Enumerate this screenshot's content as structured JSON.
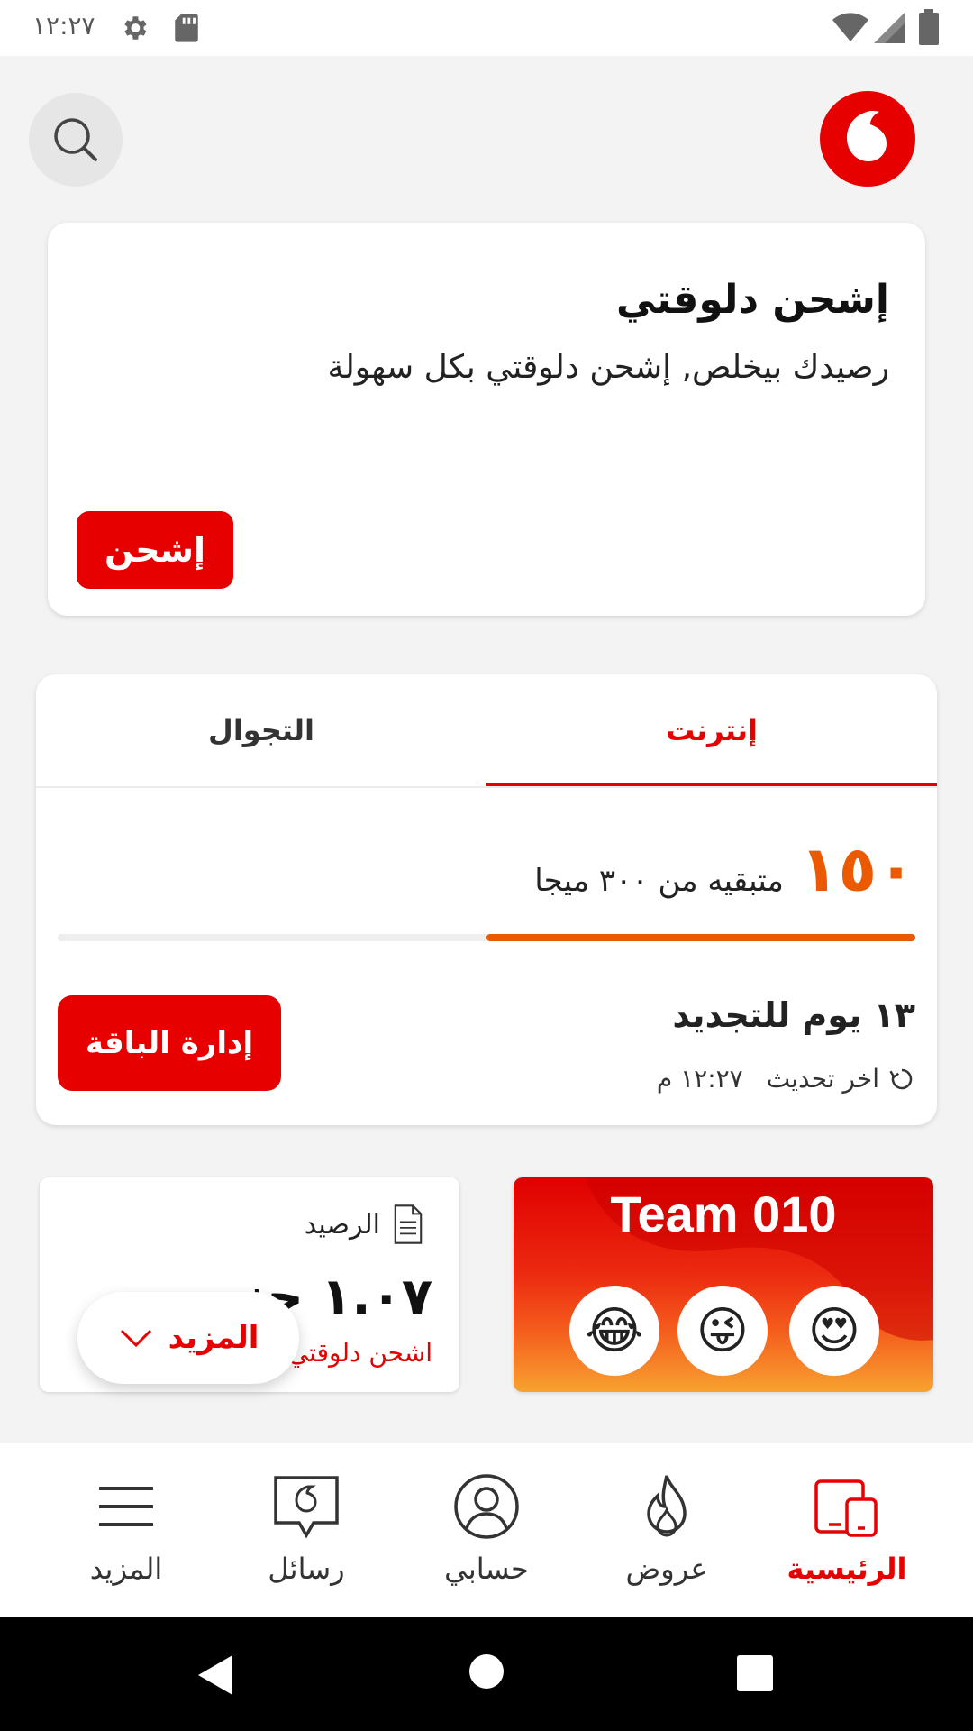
{
  "status_bar": {
    "time": "١٢:٢٧"
  },
  "header": {
    "search_icon": "search-icon",
    "logo": "vodafone-logo"
  },
  "topup_card": {
    "title": "إشحن دلوقتي",
    "description": "رصيدك بيخلص, إشحن دلوقتي بكل سهولة",
    "button_label": "إشحن"
  },
  "usage_card": {
    "tabs": [
      {
        "label": "إنترنت",
        "active": true
      },
      {
        "label": "التجوال",
        "active": false
      }
    ],
    "remaining_value": "١٥٠",
    "remaining_label": "متبقيه من ٣٠٠ ميجا",
    "progress_fraction": 0.5,
    "renewal_text": "١٣ يوم للتجديد",
    "last_update_label": "اخر تحديث",
    "last_update_time": "١٢:٢٧ م",
    "manage_button_label": "إدارة الباقة"
  },
  "balance_card": {
    "title": "الرصيد",
    "amount": "١.٠٧ جنيه",
    "topup_link": "اشحن دلوقتي"
  },
  "more_pill": {
    "label": "المزيد"
  },
  "promo_card": {
    "title": "Team 010",
    "emojis": [
      "😂",
      "😜",
      "😍"
    ]
  },
  "bottom_nav": {
    "items": [
      {
        "label": "المزيد",
        "icon": "menu-icon"
      },
      {
        "label": "رسائل",
        "icon": "messages-icon"
      },
      {
        "label": "حسابي",
        "icon": "account-icon"
      },
      {
        "label": "عروض",
        "icon": "flame-icon"
      },
      {
        "label": "الرئيسية",
        "icon": "home-devices-icon",
        "active": true
      }
    ]
  },
  "colors": {
    "accent": "#e60000",
    "usage": "#eb5a00"
  }
}
